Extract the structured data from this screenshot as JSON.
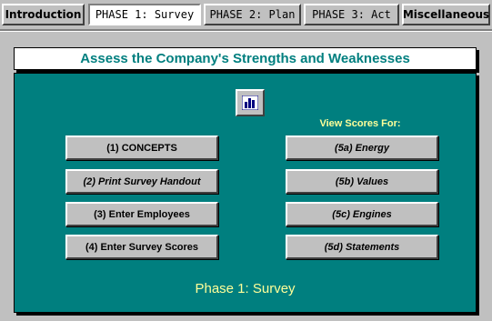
{
  "tabs": [
    {
      "label": "Introduction",
      "active": false
    },
    {
      "label": "PHASE 1: Survey",
      "active": true
    },
    {
      "label": "PHASE 2: Plan",
      "active": false
    },
    {
      "label": "PHASE 3: Act",
      "active": false
    },
    {
      "label": "Miscellaneous",
      "active": false
    }
  ],
  "title": "Assess the Company's Strengths and Weaknesses",
  "chart_button_icon": "bar-chart-icon",
  "view_scores_label": "View Scores For:",
  "left_buttons": [
    {
      "label": "(1) CONCEPTS"
    },
    {
      "label": "(2) Print Survey Handout"
    },
    {
      "label": "(3) Enter Employees"
    },
    {
      "label": "(4) Enter Survey Scores"
    }
  ],
  "right_buttons": [
    {
      "label": "(5a) Energy"
    },
    {
      "label": "(5b) Values"
    },
    {
      "label": "(5c) Engines"
    },
    {
      "label": "(5d) Statements"
    }
  ],
  "phase_label": "Phase 1: Survey",
  "colors": {
    "panel": "#007f7f",
    "title_text": "#007f7f",
    "highlight_text": "#ffff99",
    "face": "#c0c0c0"
  }
}
